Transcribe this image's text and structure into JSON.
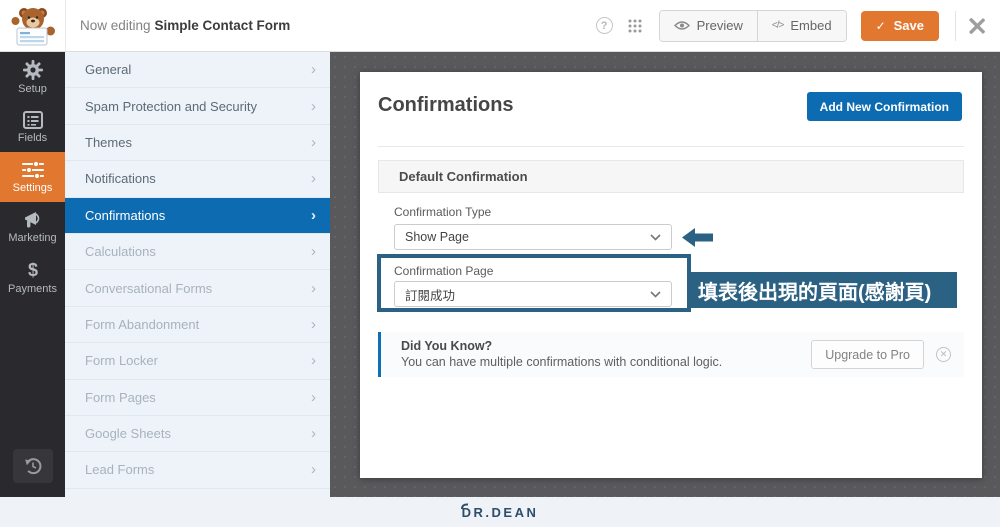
{
  "topbar": {
    "now_editing_prefix": "Now editing",
    "form_name": "Simple Contact Form",
    "preview_label": "Preview",
    "embed_label": "Embed",
    "embed_glyph": "</>",
    "save_label": "Save",
    "save_check": "✓",
    "help_glyph": "?",
    "icons": {
      "logo": "wpforms-bear-logo",
      "help": "question-circle",
      "apps": "grid-dots",
      "preview": "eye",
      "embed": "code-brackets",
      "save": "checkmark",
      "close": "x-mark"
    }
  },
  "sidebar": {
    "items": [
      {
        "label": "Setup",
        "icon": "gear-icon",
        "active": false
      },
      {
        "label": "Fields",
        "icon": "fields-list-icon",
        "active": false
      },
      {
        "label": "Settings",
        "icon": "sliders-icon",
        "active": true
      },
      {
        "label": "Marketing",
        "icon": "megaphone-icon",
        "active": false
      },
      {
        "label": "Payments",
        "icon": "dollar-icon",
        "active": false
      }
    ],
    "payments_glyph": "$",
    "history_icon": "history-icon"
  },
  "settings_menu": {
    "chevron": "›",
    "items": [
      {
        "label": "General",
        "state": "normal"
      },
      {
        "label": "Spam Protection and Security",
        "state": "normal"
      },
      {
        "label": "Themes",
        "state": "normal"
      },
      {
        "label": "Notifications",
        "state": "normal"
      },
      {
        "label": "Confirmations",
        "state": "active"
      },
      {
        "label": "Calculations",
        "state": "disabled"
      },
      {
        "label": "Conversational Forms",
        "state": "disabled"
      },
      {
        "label": "Form Abandonment",
        "state": "disabled"
      },
      {
        "label": "Form Locker",
        "state": "disabled"
      },
      {
        "label": "Form Pages",
        "state": "disabled"
      },
      {
        "label": "Google Sheets",
        "state": "disabled"
      },
      {
        "label": "Lead Forms",
        "state": "disabled"
      }
    ]
  },
  "panel": {
    "title": "Confirmations",
    "add_button_label": "Add New Confirmation",
    "section_title": "Default Confirmation",
    "confirmation_type": {
      "label": "Confirmation Type",
      "value": "Show Page"
    },
    "confirmation_page": {
      "label": "Confirmation Page",
      "value": "訂閱成功"
    },
    "annotation_text": "填表後出現的頁面(感謝頁)",
    "did_you_know": {
      "title": "Did You Know?",
      "text": "You can have multiple confirmations with conditional logic.",
      "button_label": "Upgrade to Pro",
      "dismiss_glyph": "✕"
    }
  },
  "footer": {
    "brand": "DR.DEAN"
  },
  "colors": {
    "accent_orange": "#e27730",
    "active_menu_blue": "#0d6bb2",
    "annotation_blue": "#2b6182",
    "sidebar_dark": "#2a2a2e",
    "menu_bg": "#eef3fa",
    "workspace_gray": "#59595c",
    "footer_brand_blue": "#2d4e6b"
  }
}
